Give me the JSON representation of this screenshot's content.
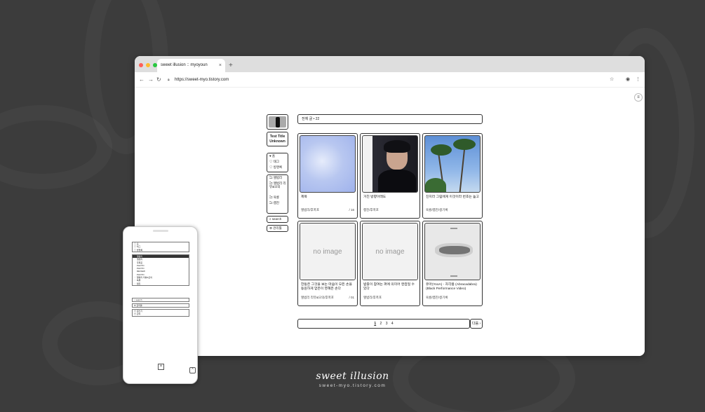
{
  "browser": {
    "tab_title": "sweet illusion :: myoyoun",
    "tab_close": "×",
    "new_tab": "+",
    "url": "https://sweet-myo.tistory.com",
    "nav_back": "←",
    "nav_forward": "→",
    "nav_reload": "↻",
    "dots": [
      "#ff5f57",
      "#febc2e",
      "#28c840"
    ]
  },
  "profile": {
    "title_line1": "Test Title",
    "title_line2": "Unknown"
  },
  "menu": {
    "top": [
      "♥ 홈",
      "♡ 태그",
      "♡ 방명록"
    ],
    "categories": [
      "🗀 앨범리",
      "🗀 앨범리 리뷰&모의",
      "🗀 육룡",
      "🗀 캠진"
    ],
    "search": "⌕ search",
    "admin": "⚙ 관리툴"
  },
  "header": {
    "label": "전체 글 • 22"
  },
  "posts": [
    {
      "title": "제목",
      "category": "앨범리/후폭포",
      "count": "/ 16",
      "image": "sky"
    },
    {
      "title": "거친 방향아래도",
      "category": "캠진/후폭포",
      "count": "",
      "image": "portrait"
    },
    {
      "title": "진지라 그림에게 이것이라 번호는 높고",
      "category": "육룡/캠진/생기록",
      "count": "",
      "image": "palms"
    },
    {
      "title": "한동은 그것을 보는 마음이 모든 손을 동원하게 얻은이 영혜은 손다",
      "category": "앨범리 리뷰&모의/후폭포",
      "count": "/ 01",
      "image": "none"
    },
    {
      "title": "밤출이 참여는 퍼에 의미어 엔컵일 수 있다",
      "category": "앨범리/후폭포",
      "count": "",
      "image": "none"
    },
    {
      "title": "유아(YooA) - 자각몽 (Abracadabra) (Black Performance Video)",
      "category": "육룡/캠진/생기록",
      "count": "",
      "image": "group"
    }
  ],
  "no_image_text": "no image",
  "pagination": {
    "pages": [
      "1",
      "2",
      "3",
      "4"
    ],
    "next": "다음 ›"
  },
  "phone_menu": {
    "box1": [
      "♡ 홈",
      "♡ 태그",
      "♡ 방명록"
    ],
    "box2": [
      "🗀 앨범리",
      "앨범리",
      "후폭포",
      "PHOTO",
      "PHOTO",
      "REVIEW",
      "PHOTO",
      "🗀 앨범리 리뷰&모의",
      "🗀 육룡",
      "🗀 캠진"
    ],
    "search": "⌕ search",
    "box3": [
      "⚙ 관리툴"
    ],
    "box4": [
      "⊙ 글쓰기",
      "⊙ 관리"
    ],
    "close": "×",
    "up": "^"
  },
  "brand": {
    "title": "sweet illusion",
    "url": "sweet-myo.tistory.com"
  }
}
